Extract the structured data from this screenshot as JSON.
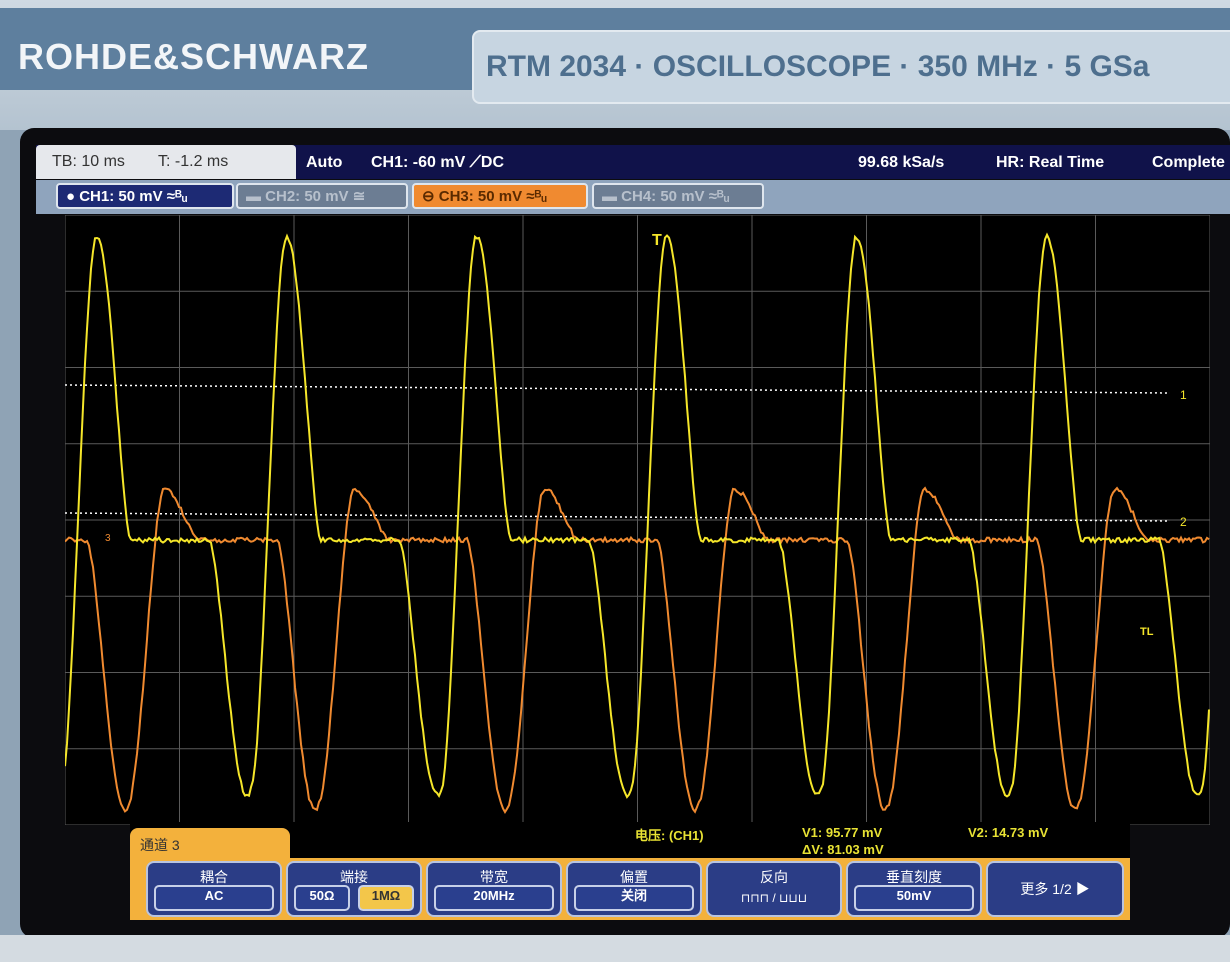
{
  "bezel": {
    "brand": "ROHDE&SCHWARZ",
    "model": "RTM 2034 · OSCILLOSCOPE · 350 MHz · 5 GSa"
  },
  "status": {
    "timebase": "TB: 10 ms",
    "trigger_time": "T: -1.2 ms",
    "mode": "Auto",
    "trigger": "CH1: -60 mV ⟋DC",
    "sample_rate": "99.68 kSa/s",
    "acq": "HR: Real Time",
    "state": "Complete"
  },
  "channels": [
    {
      "label": "● CH1: 50 mV ≈ᴮᵤ",
      "color": "#f5e62a",
      "active": true
    },
    {
      "label": "▬ CH2: 50 mV ≅",
      "color": "#9aa5b5",
      "active": false
    },
    {
      "label": "⊖ CH3: 50 mV ≈ᴮᵤ",
      "color": "#f08a30",
      "active": true
    },
    {
      "label": "▬ CH4: 50 mV ≈ᴮᵤ",
      "color": "#9aa5b5",
      "active": false
    }
  ],
  "markers": {
    "trigger": "T",
    "cursor1": "1",
    "cursor2": "2",
    "ch3": "3",
    "trigger_level": "TL"
  },
  "measurement": {
    "label": "电压:  (CH1)",
    "v1": "V1: 95.77 mV",
    "v2": "V2: 14.73 mV",
    "dv": "ΔV: 81.03 mV"
  },
  "menu": {
    "title": "通道 3",
    "keys": [
      {
        "title": "耦合",
        "value": "AC"
      },
      {
        "title": "端接",
        "options": [
          "50Ω",
          "1MΩ"
        ],
        "selected": "1MΩ"
      },
      {
        "title": "带宽",
        "value": "20MHz"
      },
      {
        "title": "偏置",
        "value": "关闭"
      },
      {
        "title": "反向",
        "value": "⊓⊓⊓ / ⊔⊔⊔"
      },
      {
        "title": "垂直刻度",
        "value": "50mV"
      },
      {
        "title": "更多 1/2",
        "value": "▶"
      }
    ]
  },
  "colors": {
    "ch1": "#f5e62a",
    "ch3": "#f08a30",
    "grid": "#5a5a5a",
    "cursor": "#ffffff"
  }
}
